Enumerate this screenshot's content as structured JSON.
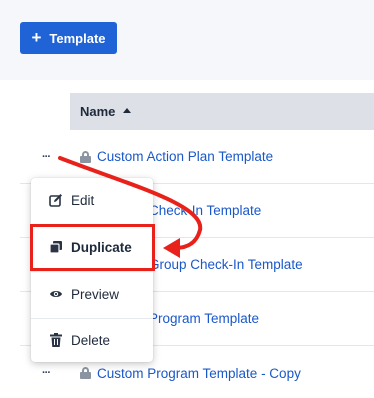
{
  "toolbar": {
    "add_label": "Template"
  },
  "table": {
    "name_header": "Name",
    "row_action_glyph": "···",
    "rows": [
      {
        "name": "Custom Action Plan Template"
      },
      {
        "name": "Check-In Template"
      },
      {
        "name": "Group Check-In Template"
      },
      {
        "name": "Program Template"
      },
      {
        "name": "Custom Program Template - Copy"
      }
    ]
  },
  "menu": {
    "items": [
      {
        "label": "Edit",
        "icon": "pencil-square-icon"
      },
      {
        "label": "Duplicate",
        "icon": "copy-icon"
      },
      {
        "label": "Preview",
        "icon": "eye-icon"
      },
      {
        "label": "Delete",
        "icon": "trash-icon"
      }
    ]
  },
  "annotation": {
    "highlight_target": "Duplicate",
    "color": "#e8221b"
  },
  "colors": {
    "primary": "#1f63d6",
    "link": "#1a58c9",
    "header_bg": "#dde1e7",
    "annotation": "#e8221b"
  }
}
